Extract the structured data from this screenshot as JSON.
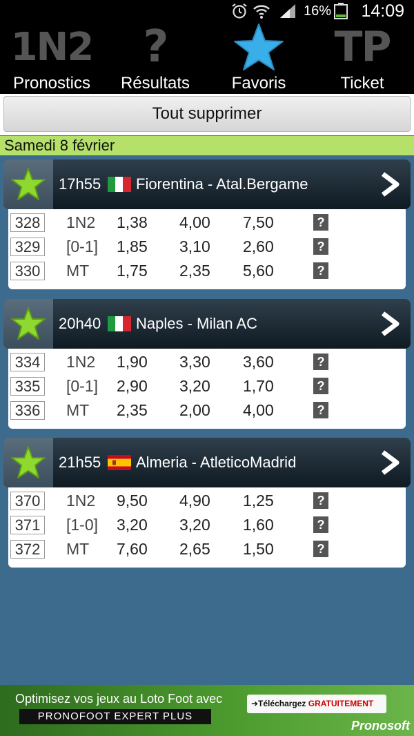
{
  "status_bar": {
    "battery": "16%",
    "time": "14:09"
  },
  "tabs": [
    {
      "glyph": "1N2",
      "label": "Pronostics"
    },
    {
      "glyph": "?",
      "label": "Résultats"
    },
    {
      "glyph": "",
      "label": "Favoris"
    },
    {
      "glyph": "TP",
      "label": "Ticket"
    }
  ],
  "delete_button": "Tout supprimer",
  "date_label": "Samedi 8 février",
  "matches": [
    {
      "time": "17h55",
      "teams": "Fiorentina - Atal.Bergame",
      "flag": "italy-flag",
      "rows": [
        {
          "num": "328",
          "type": "1N2",
          "o1": "1,38",
          "o2": "4,00",
          "o3": "7,50"
        },
        {
          "num": "329",
          "type": "[0-1]",
          "o1": "1,85",
          "o2": "3,10",
          "o3": "2,60"
        },
        {
          "num": "330",
          "type": "MT",
          "o1": "1,75",
          "o2": "2,35",
          "o3": "5,60"
        }
      ]
    },
    {
      "time": "20h40",
      "teams": "Naples - Milan AC",
      "flag": "italy-flag",
      "rows": [
        {
          "num": "334",
          "type": "1N2",
          "o1": "1,90",
          "o2": "3,30",
          "o3": "3,60"
        },
        {
          "num": "335",
          "type": "[0-1]",
          "o1": "2,90",
          "o2": "3,20",
          "o3": "1,70"
        },
        {
          "num": "336",
          "type": "MT",
          "o1": "2,35",
          "o2": "2,00",
          "o3": "4,00"
        }
      ]
    },
    {
      "time": "21h55",
      "teams": "Almeria - AtleticoMadrid",
      "flag": "spain-flag",
      "rows": [
        {
          "num": "370",
          "type": "1N2",
          "o1": "9,50",
          "o2": "4,90",
          "o3": "1,25"
        },
        {
          "num": "371",
          "type": "[1-0]",
          "o1": "3,20",
          "o2": "3,20",
          "o3": "1,60"
        },
        {
          "num": "372",
          "type": "MT",
          "o1": "7,60",
          "o2": "2,65",
          "o3": "1,50"
        }
      ]
    }
  ],
  "help_glyph": "?",
  "ad": {
    "line1": "Optimisez vos jeux au Loto Foot avec",
    "line2": "PRONOFOOT EXPERT PLUS",
    "download_prefix": "➜Téléchargez ",
    "download_highlight": "GRATUITEMENT",
    "brand": "Pronosoft"
  }
}
